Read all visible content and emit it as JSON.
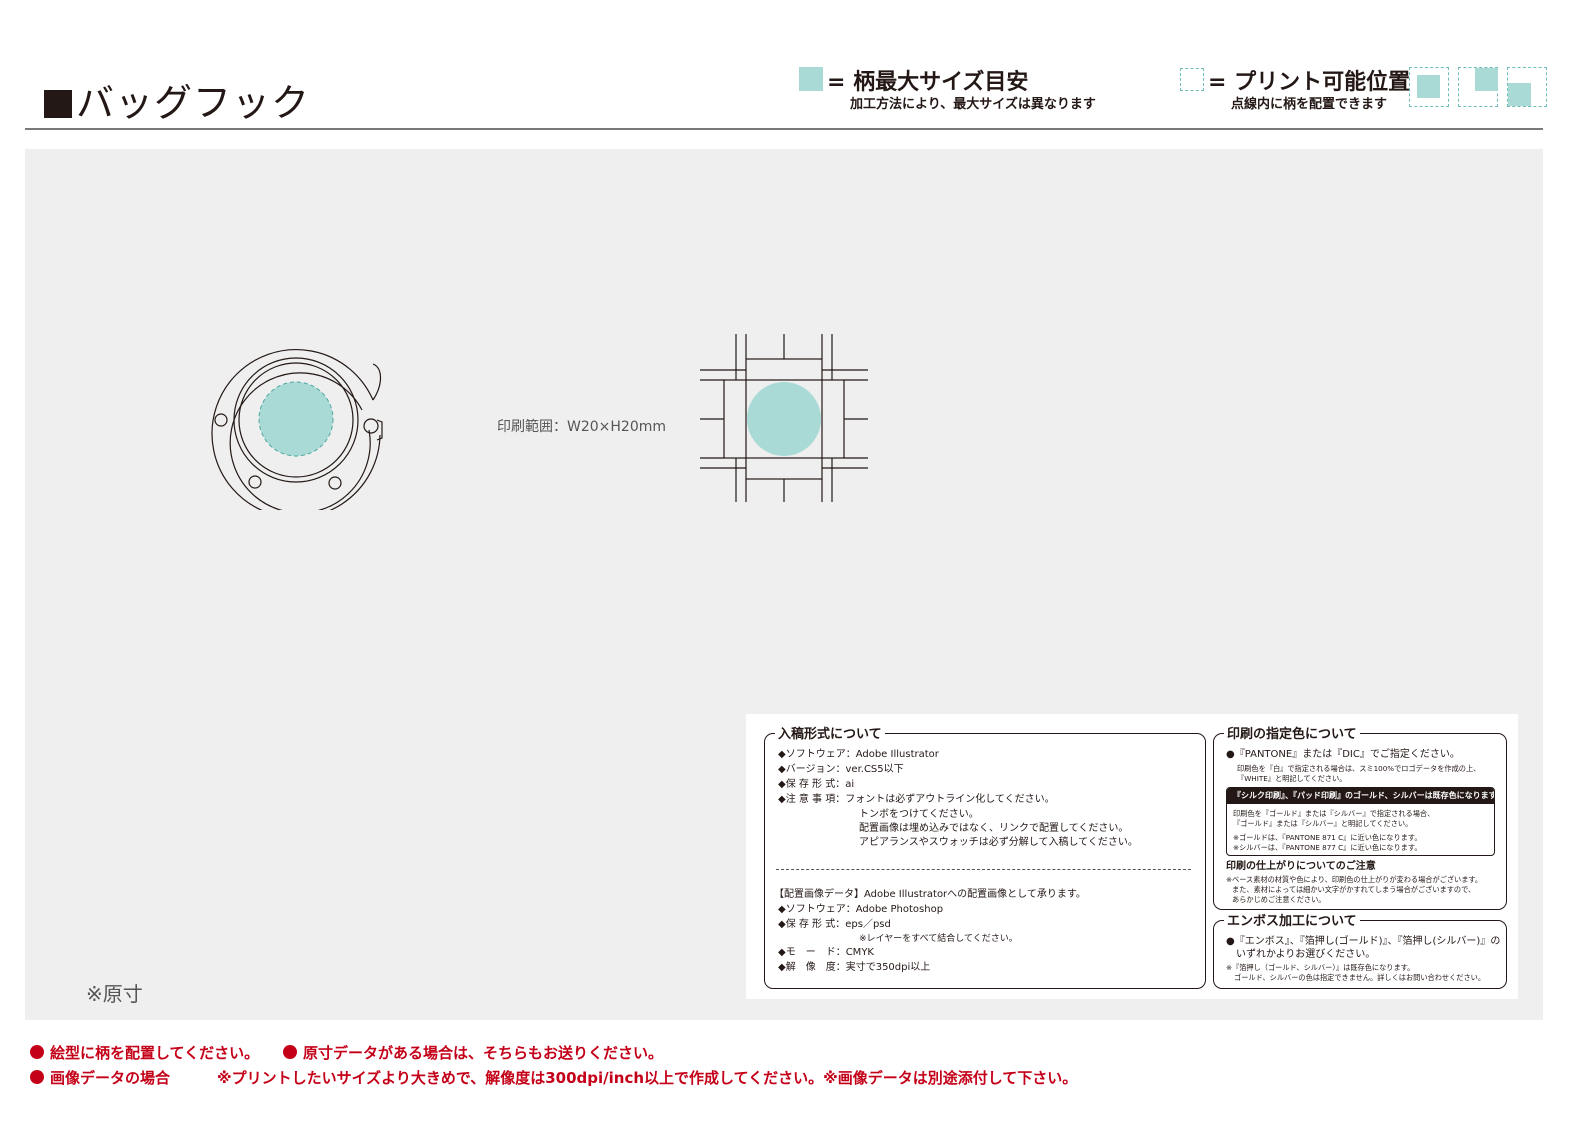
{
  "header": {
    "title": "バッグフック"
  },
  "legend": {
    "max_size": {
      "label": "= 柄最大サイズ目安",
      "sub": "加工方法により、最大サイズは異なります"
    },
    "printable": {
      "label": "= プリント可能位置",
      "sub": "点線内に柄を配置できます"
    }
  },
  "canvas": {
    "print_range": "印刷範囲：W20×H20mm",
    "actual_size_note": "※原寸"
  },
  "colors": {
    "accent_teal": "#a9dad6",
    "teal_dash": "#6fbcb6",
    "canvas_bg": "#eeefee",
    "note_red": "#c40018",
    "ink": "#231815"
  },
  "spec": {
    "submission": {
      "title": "入稿形式について",
      "rows": [
        {
          "label": "◆ソフトウェア：",
          "value": "Adobe Illustrator"
        },
        {
          "label": "◆バージョン：",
          "value": "ver.CS5以下"
        },
        {
          "label": "◆保 存 形 式：",
          "value": "ai"
        },
        {
          "label": "◆注 意 事 項：",
          "value": "フォントは必ずアウトライン化してください。"
        }
      ],
      "notes_cont": [
        "トンボをつけてください。",
        "配置画像は埋め込みではなく、リンクで配置してください。",
        "アピアランスやスウォッチは必ず分解して入稿してください。"
      ],
      "placed_heading": "【配置画像データ】Adobe Illustratorへの配置画像として承ります。",
      "placed_rows": [
        {
          "label": "◆ソフトウェア：",
          "value": "Adobe Photoshop"
        },
        {
          "label": "◆保 存 形 式：",
          "value": "eps／psd"
        },
        {
          "label": "",
          "value": "※レイヤーをすべて結合してください。"
        },
        {
          "label": "◆モ　ー　ド：",
          "value": "CMYK"
        },
        {
          "label": "◆解　像　度：",
          "value": "実寸で350dpi以上"
        }
      ]
    },
    "color": {
      "title": "印刷の指定色について",
      "line1": "●『PANTONE』または『DIC』でご指定ください。",
      "line2": "印刷色を『白』で指定される場合は、スミ100%でロゴデータを作成の上、",
      "line3": "『WHITE』と明記してください。",
      "banner": "『シルク印刷』、『パッド印刷』のゴールド、シルバーは既存色になります。",
      "inner1": "印刷色を『ゴールド』または『シルバー』で指定される場合、",
      "inner2": "『ゴールド』または『シルバー』と明記してください。",
      "inner3": "※ゴールドは、『PANTONE 871 C』に近い色になります。",
      "inner4": "※シルバーは、『PANTONE 877 C』に近い色になります。",
      "finish_title": "印刷の仕上がりについてのご注意",
      "finish1": "※ベース素材の材質や色により、印刷色の仕上がりが変わる場合がございます。",
      "finish2": "また、素材によっては細かい文字がかすれてしまう場合がございますので、",
      "finish3": "あらかじめご注意ください。"
    },
    "emboss": {
      "title": "エンボス加工について",
      "line1": "●『エンボス』、『箔押し(ゴールド)』、『箔押し(シルバー)』の",
      "line2": "いずれかよりお選びください。",
      "line3": "※『箔押し（ゴールド、シルバー）』は既存色になります。",
      "line4": "ゴールド、シルバーの色は指定できません。詳しくはお問い合わせください。"
    }
  },
  "footer": {
    "note1": "絵型に柄を配置してください。",
    "note2": "原寸データがある場合は、そちらもお送りください。",
    "note3": "画像データの場合",
    "note4": "※プリントしたいサイズより大きめで、解像度は300dpi/inch以上で作成してください。※画像データは別途添付して下さい。"
  }
}
